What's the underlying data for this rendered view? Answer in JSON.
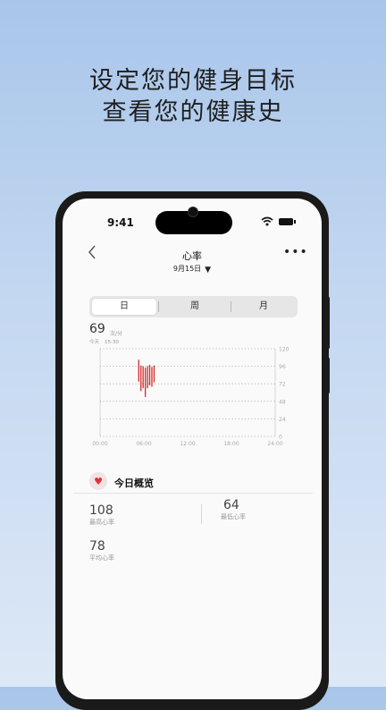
{
  "promo": {
    "line1": "设定您的健身目标",
    "line2": "查看您的健康史"
  },
  "status_bar": {
    "time": "9:41"
  },
  "header": {
    "title": "心率",
    "date": "9月15日",
    "back_icon": "chevron-left-icon",
    "more_icon": "more-icon",
    "more_glyph": "•••",
    "date_caret": "▼"
  },
  "tabs": [
    {
      "label": "日",
      "active": true
    },
    {
      "label": "周",
      "active": false
    },
    {
      "label": "月",
      "active": false
    }
  ],
  "current": {
    "value": "69",
    "unit": "次/分",
    "day": "今天",
    "time": "15:30"
  },
  "chart_data": {
    "type": "bar",
    "x_ticks": [
      "00:00",
      "06:00",
      "12:00",
      "18:00",
      "24:00"
    ],
    "y_ticks": [
      "120",
      "96",
      "72",
      "48",
      "24",
      "0"
    ],
    "ylim": [
      0,
      120
    ],
    "xlim_hours": [
      0,
      24
    ],
    "color": "#d42a2a",
    "series": [
      {
        "hour": 5.3,
        "low": 75,
        "high": 105
      },
      {
        "hour": 5.6,
        "low": 62,
        "high": 97
      },
      {
        "hour": 5.9,
        "low": 66,
        "high": 96
      },
      {
        "hour": 6.2,
        "low": 54,
        "high": 94
      },
      {
        "hour": 6.5,
        "low": 66,
        "high": 96
      },
      {
        "hour": 6.8,
        "low": 70,
        "high": 98
      },
      {
        "hour": 7.1,
        "low": 68,
        "high": 95
      },
      {
        "hour": 7.4,
        "low": 74,
        "high": 97
      }
    ]
  },
  "summary": {
    "title": "今日概览",
    "icon": "heart-icon",
    "icon_glyph": "♥",
    "stats": [
      {
        "value": "108",
        "label": "最高心率"
      },
      {
        "value": "64",
        "label": "最低心率"
      },
      {
        "value": "78",
        "label": "平均心率"
      }
    ]
  },
  "colors": {
    "accent": "#d42a2a",
    "background_top": "#a9c6ea",
    "background_bottom": "#dde8f6"
  }
}
